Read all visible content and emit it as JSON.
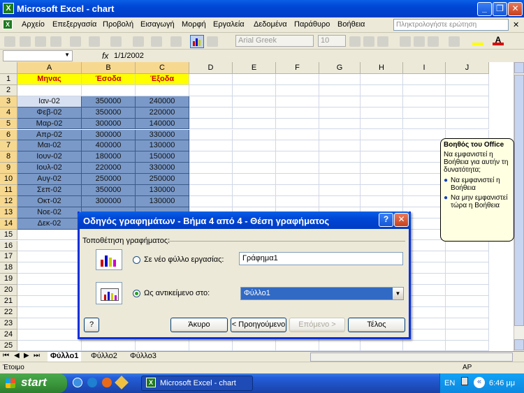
{
  "window": {
    "title": "Microsoft Excel - chart"
  },
  "menu": [
    "Αρχείο",
    "Επεξεργασία",
    "Προβολή",
    "Εισαγωγή",
    "Μορφή",
    "Εργαλεία",
    "Δεδομένα",
    "Παράθυρο",
    "Βοήθεια"
  ],
  "help_placeholder": "Πληκτρολογήστε ερώτηση",
  "toolbar": {
    "font": "Arial Greek",
    "size": "10"
  },
  "formula": {
    "fx": "fx",
    "value": "1/1/2002"
  },
  "columns": [
    "A",
    "B",
    "C",
    "D",
    "E",
    "F",
    "G",
    "H",
    "I",
    "J"
  ],
  "rows": [
    "1",
    "2",
    "3",
    "4",
    "5",
    "6",
    "7",
    "8",
    "9",
    "10",
    "11",
    "12",
    "13",
    "14",
    "15",
    "16",
    "17",
    "18",
    "19",
    "20",
    "21",
    "22",
    "23",
    "24",
    "25"
  ],
  "headers": {
    "a": "Μηνας",
    "b": "Έσοδα",
    "c": "Έξοδα"
  },
  "data": [
    [
      "Ιαν-02",
      "350000",
      "240000"
    ],
    [
      "Φεβ-02",
      "350000",
      "220000"
    ],
    [
      "Μαρ-02",
      "300000",
      "140000"
    ],
    [
      "Απρ-02",
      "300000",
      "330000"
    ],
    [
      "Μαι-02",
      "400000",
      "130000"
    ],
    [
      "Ιουν-02",
      "180000",
      "150000"
    ],
    [
      "Ιουλ-02",
      "220000",
      "330000"
    ],
    [
      "Αυγ-02",
      "250000",
      "250000"
    ],
    [
      "Σεπ-02",
      "350000",
      "130000"
    ],
    [
      "Οκτ-02",
      "300000",
      "130000"
    ],
    [
      "Νοε-02",
      "",
      ""
    ],
    [
      "Δεκ-02",
      "",
      ""
    ]
  ],
  "sheets": [
    "Φύλλο1",
    "Φύλλο2",
    "Φύλλο3"
  ],
  "status": {
    "left": "Έτοιμο",
    "right": "AP"
  },
  "dialog": {
    "title": "Οδηγός γραφημάτων - Βήμα 4 από 4 - Θέση γραφήματος",
    "group_label": "Τοποθέτηση γραφήματος:",
    "option1": "Σε νέο φύλλο εργασίας:",
    "option1_value": "Γράφημα1",
    "option2": "Ως αντικείμενο στο:",
    "option2_value": "Φύλλο1",
    "cancel": "Άκυρο",
    "back": "< Προηγούμενο",
    "next": "Επόμενο >",
    "finish": "Τέλος"
  },
  "assistant": {
    "title": "Βοηθός του Office",
    "text": "Να εμφανιστεί η Βοήθεια για αυτήν τη δυνατότητα;",
    "opt1": "Να εμφανιστεί η Βοήθεια",
    "opt2": "Να μην εμφανιστεί τώρα η Βοήθεια"
  },
  "taskbar": {
    "start": "start",
    "task": "Microsoft Excel - chart",
    "lang": "EN",
    "clock": "6:46 μμ"
  },
  "colors": {
    "accent": "#0046d5",
    "header_fill": "#ffff00",
    "header_text": "#d00000",
    "selection": "#7a99c8"
  }
}
